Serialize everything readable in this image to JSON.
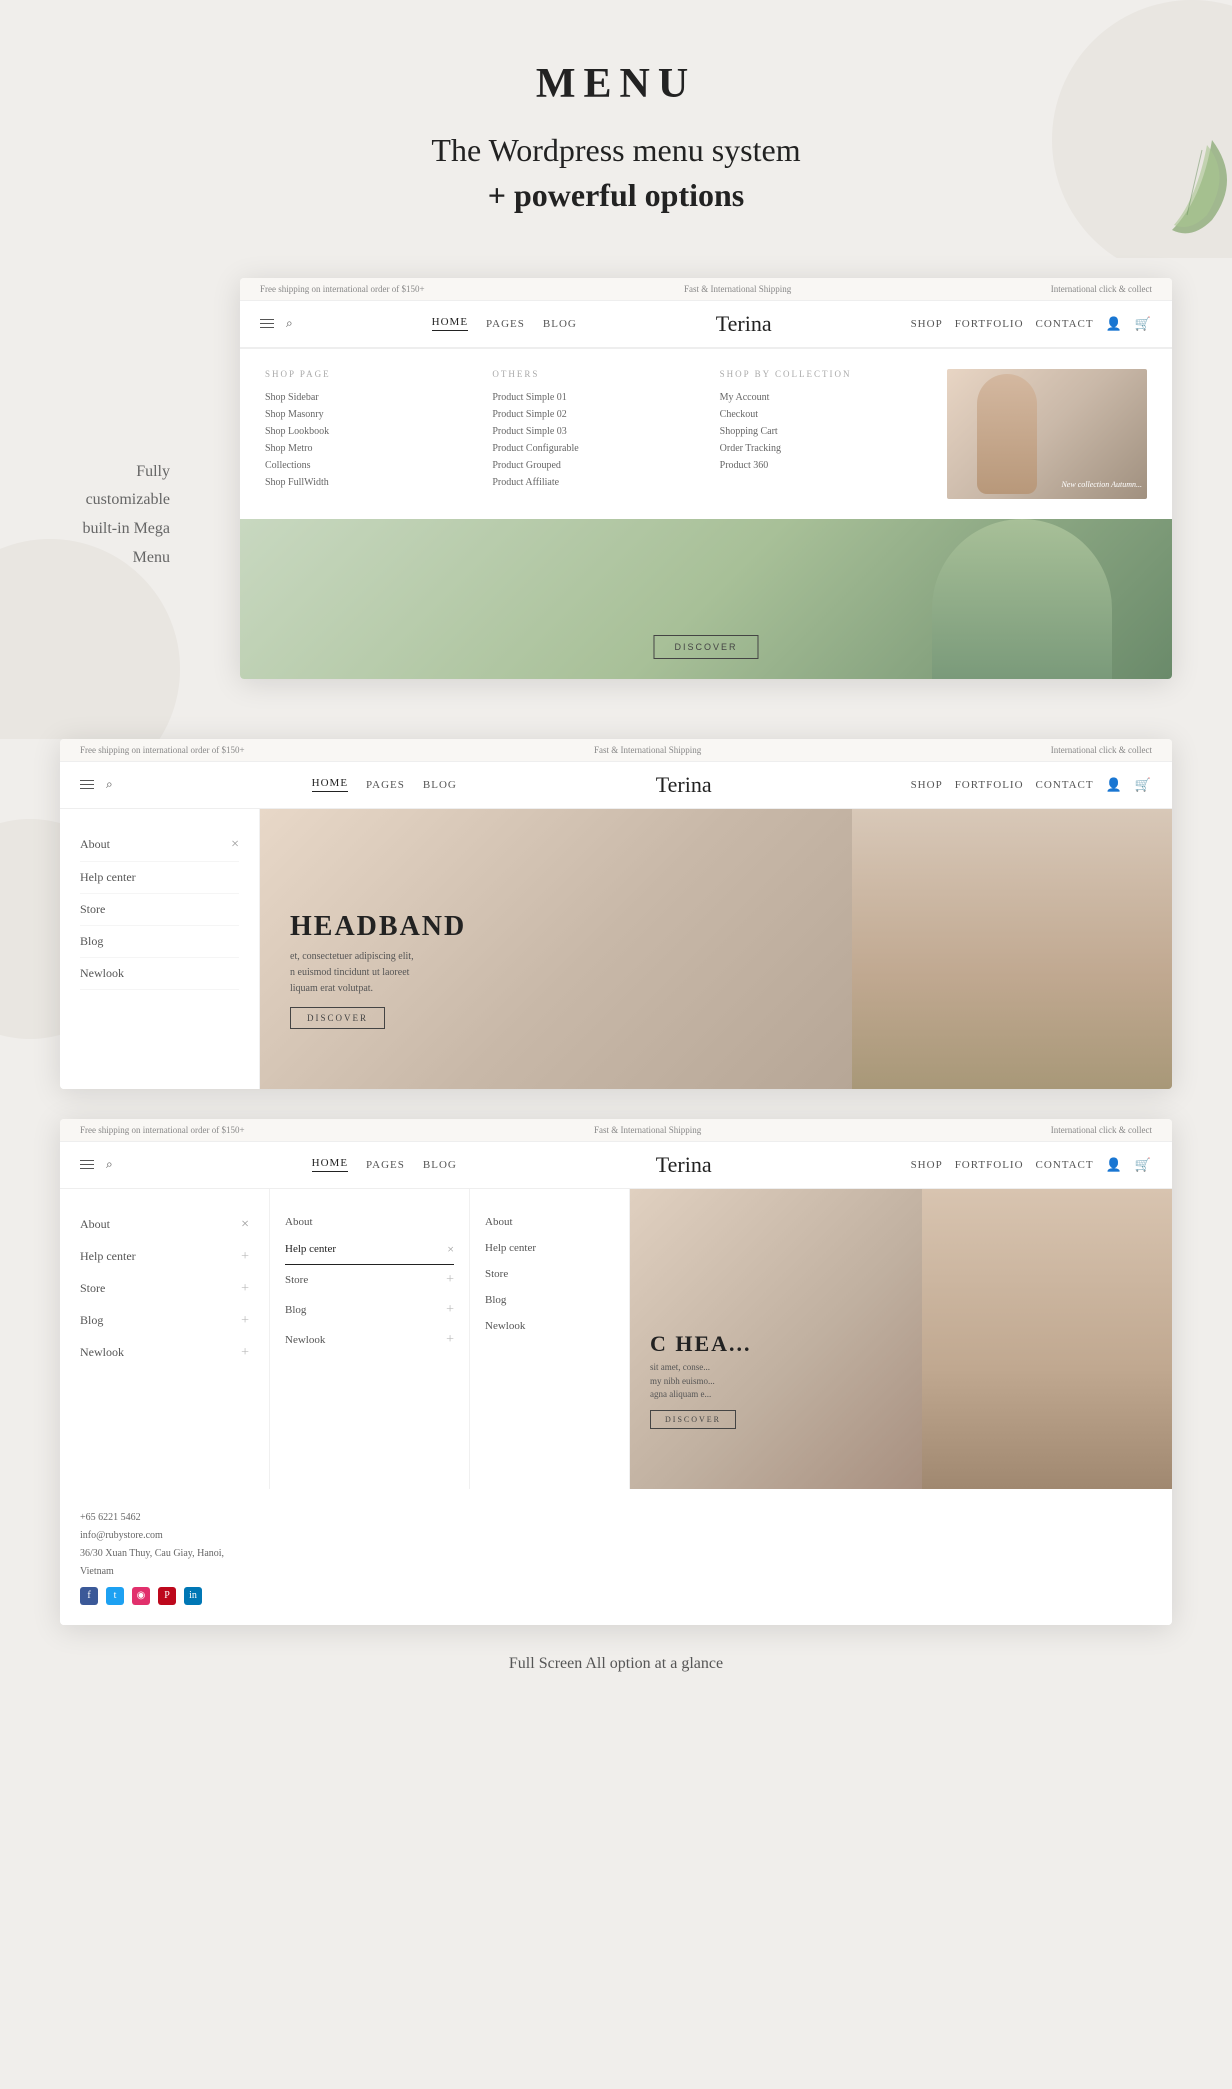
{
  "page": {
    "title": "MENU",
    "subtitle_line1": "The Wordpress menu system",
    "subtitle_line2": "+ powerful options",
    "bottom_caption": "Full Screen All option at a glance"
  },
  "mega_menu_label": {
    "line1": "Fully",
    "line2": "customizable",
    "line3": "built-in Mega",
    "line4": "Menu"
  },
  "mockup1": {
    "topbar": {
      "left": "Free shipping on international order of $150+",
      "center": "Fast & International Shipping",
      "right": "International click & collect"
    },
    "nav": {
      "links": [
        "HOME",
        "PAGES",
        "BLOG",
        "SHOP",
        "FORTFOLIO",
        "CONTACT"
      ],
      "active": "HOME",
      "brand": "Terina"
    },
    "mega_dropdown": {
      "col1_title": "SHOP PAGE",
      "col1_items": [
        "Shop Sidebar",
        "Shop Masonry",
        "Shop Lookbook",
        "Shop Metro",
        "Collections",
        "Shop FullWidth"
      ],
      "col2_title": "OTHERS",
      "col2_items": [
        "Product Simple 01",
        "Product Simple 02",
        "Product Simple 03",
        "Product Configurable",
        "Product Grouped",
        "Product Affiliate"
      ],
      "col3_title": "SHOP BY COLLECTION",
      "col3_items": [
        "My Account",
        "Checkout",
        "Shopping Cart",
        "Order Tracking",
        "Product 360"
      ],
      "image_label": "New collection Autumn..."
    }
  },
  "mockup2": {
    "topbar": {
      "left": "Free shipping on international order of $150+",
      "center": "Fast & International Shipping",
      "right": "International click & collect"
    },
    "nav": {
      "links": [
        "HOME",
        "PAGES",
        "BLOG",
        "SHOP",
        "FORTFOLIO",
        "CONTACT"
      ],
      "active": "HOME",
      "brand": "Terina"
    },
    "sidebar": {
      "items": [
        "About",
        "Help center",
        "Store",
        "Blog",
        "Newlook"
      ]
    },
    "hero": {
      "title": "HEADBAND",
      "body_line1": "et, consectetuer adipiscing elit,",
      "body_line2": "n euismod tincidunt ut laoreet",
      "body_line3": "liquam erat volutpat.",
      "discover": "DISCOVER"
    }
  },
  "mockup3": {
    "topbar": {
      "left": "Free shipping on international order of $150+",
      "center": "Fast & International Shipping",
      "right": "International click & collect"
    },
    "nav": {
      "links": [
        "HOME",
        "PAGES",
        "BLOG",
        "SHOP",
        "FORTFOLIO",
        "CONTACT"
      ],
      "active": "HOME",
      "brand": "Terina"
    },
    "sidebar_col1": {
      "items": [
        "About",
        "Help center",
        "Store",
        "Blog",
        "Newlook"
      ]
    },
    "sidebar_col2": {
      "items": [
        "About",
        "Help center",
        "Store",
        "Blog",
        "Newlook"
      ],
      "active": "Help center"
    },
    "sidebar_col3": {
      "items": [
        "About",
        "Help center",
        "Store",
        "Blog",
        "Newlook"
      ]
    },
    "hero": {
      "title": "C HEA...",
      "body_line1": "sit amet, conse...",
      "body_line2": "my nibh euismo...",
      "body_line3": "agna aliquam e...",
      "discover": "DISCOVER"
    },
    "contact": {
      "phone": "+65 6221 5462",
      "email": "info@rubystore.com",
      "address": "36/30 Xuan Thuy, Cau Giay, Hanoi, Vietnam"
    }
  }
}
